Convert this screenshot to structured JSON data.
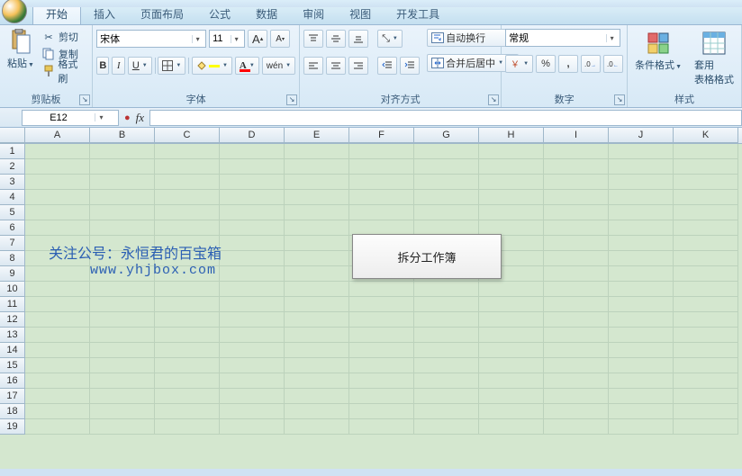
{
  "tabs": [
    "开始",
    "插入",
    "页面布局",
    "公式",
    "数据",
    "审阅",
    "视图",
    "开发工具"
  ],
  "activeTab": 0,
  "clipboard": {
    "paste": "粘贴",
    "cut": "剪切",
    "copy": "复制",
    "formatPainter": "格式刷",
    "groupLabel": "剪贴板"
  },
  "font": {
    "name": "宋体",
    "size": "11",
    "increase": "A",
    "decrease": "A",
    "bold": "B",
    "italic": "I",
    "underline": "U",
    "groupLabel": "字体"
  },
  "align": {
    "wrap": "自动换行",
    "merge": "合并后居中",
    "groupLabel": "对齐方式"
  },
  "number": {
    "format": "常规",
    "percent": "%",
    "comma": ",",
    "groupLabel": "数字"
  },
  "style": {
    "cond": "条件格式",
    "table": "套用\n表格格式",
    "groupLabel": "样式"
  },
  "nameBox": "E12",
  "columns": [
    "A",
    "B",
    "C",
    "D",
    "E",
    "F",
    "G",
    "H",
    "I",
    "J",
    "K"
  ],
  "rows": [
    "1",
    "2",
    "3",
    "4",
    "5",
    "6",
    "7",
    "8",
    "9",
    "10",
    "11",
    "12",
    "13",
    "14",
    "15",
    "16",
    "17",
    "18",
    "19"
  ],
  "overlay": {
    "line1": "关注公号：永恒君的百宝箱",
    "line2": "www.yhjbox.com",
    "button": "拆分工作簿"
  }
}
